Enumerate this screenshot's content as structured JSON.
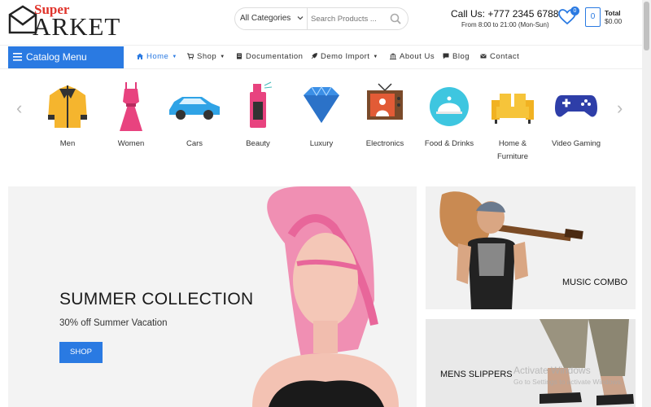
{
  "logo": {
    "super": "Super",
    "brand": "ARKET"
  },
  "search": {
    "category": "All Categories",
    "placeholder": "Search Products ..."
  },
  "contact": {
    "call": "Call Us: +777 2345 6788",
    "hours": "From 8:00 to 21:00 (Mon-Sun)"
  },
  "wishlist": {
    "count": "0"
  },
  "cart": {
    "count": "0",
    "total_label": "Total",
    "total_value": "$0.00"
  },
  "nav": {
    "catalog": "Catalog Menu",
    "items": [
      {
        "label": "Home",
        "icon": "home-icon"
      },
      {
        "label": "Shop",
        "icon": "cart-icon"
      },
      {
        "label": "Documentation",
        "icon": "document-icon"
      },
      {
        "label": "Demo Import",
        "icon": "rocket-icon"
      },
      {
        "label": "About Us",
        "icon": "bank-icon"
      },
      {
        "label": "Blog",
        "icon": "comment-icon"
      },
      {
        "label": "Contact",
        "icon": "mail-icon"
      }
    ]
  },
  "categories": [
    {
      "label": "Men"
    },
    {
      "label": "Women"
    },
    {
      "label": "Cars"
    },
    {
      "label": "Beauty"
    },
    {
      "label": "Luxury"
    },
    {
      "label": "Electronics"
    },
    {
      "label": "Food & Drinks"
    },
    {
      "label": "Home &",
      "label2": "Furniture"
    },
    {
      "label": "Video Gaming"
    }
  ],
  "hero": {
    "title": "SUMMER COLLECTION",
    "subtitle": "30% off Summer Vacation",
    "button": "SHOP"
  },
  "promos": [
    {
      "label": "MUSIC COMBO"
    },
    {
      "label": "MENS SLIPPERS"
    }
  ],
  "watermark": {
    "line1": "Activate Windows",
    "line2": "Go to Settings to activate Windows."
  },
  "colors": {
    "accent": "#2a7ae2",
    "logo_red": "#e0332b"
  }
}
